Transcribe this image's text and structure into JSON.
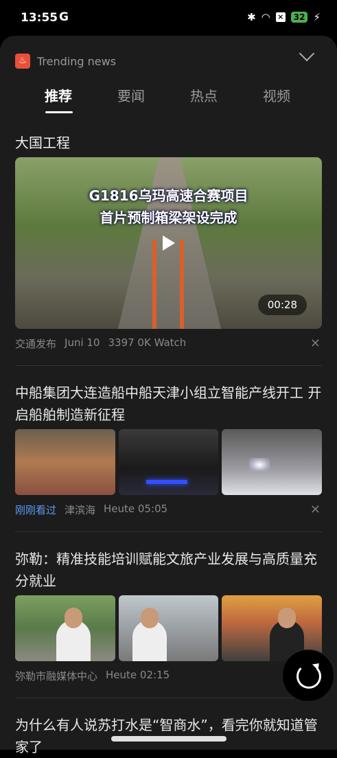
{
  "status": {
    "time": "13:55",
    "g": "G",
    "battery": "32"
  },
  "widget": {
    "name": "Trending news"
  },
  "tabs": [
    "推荐",
    "要闻",
    "热点",
    "视频"
  ],
  "section": "大国工程",
  "video": {
    "caption1": "G1816乌玛高速合赛项目",
    "caption2": "首片预制箱梁架设完成",
    "duration": "00:28",
    "source": "交通发布",
    "date": "Juni 10",
    "views": "3397 0K Watch"
  },
  "article1": {
    "title": "中船集团大连造船中船天津小组立智能产线开工 开启船舶制造新征程",
    "badge": "刚刚看过",
    "source": "津滨海",
    "time": "Heute 05:05"
  },
  "article2": {
    "title": "弥勒：精准技能培训赋能文旅产业发展与高质量充分就业",
    "source": "弥勒市融媒体中心",
    "time": "Heute 02:15"
  },
  "article3": {
    "title": "为什么有人说苏打水是“智商水”，看完你就知道管家了"
  },
  "close_glyph": "✕"
}
